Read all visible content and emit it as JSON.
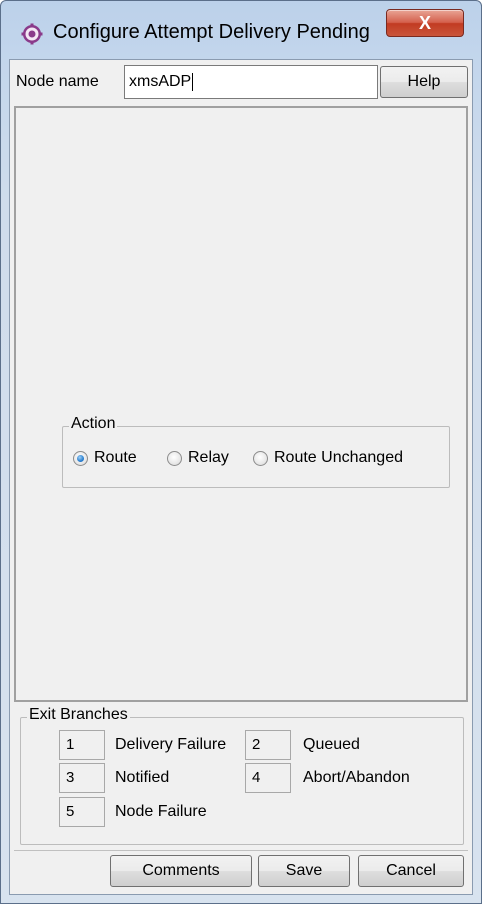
{
  "window": {
    "title": "Configure Attempt Delivery Pending",
    "close_label": "X",
    "app_icon": "gear-app-icon"
  },
  "node": {
    "label": "Node name",
    "value": "xmsADP",
    "help_label": "Help"
  },
  "action": {
    "legend": "Action",
    "options": [
      {
        "label": "Route",
        "checked": true
      },
      {
        "label": "Relay",
        "checked": false
      },
      {
        "label": "Route Unchanged",
        "checked": false
      }
    ]
  },
  "exit_branches": {
    "legend": "Exit Branches",
    "items": [
      {
        "number": "1",
        "label": "Delivery Failure"
      },
      {
        "number": "2",
        "label": "Queued"
      },
      {
        "number": "3",
        "label": "Notified"
      },
      {
        "number": "4",
        "label": "Abort/Abandon"
      },
      {
        "number": "5",
        "label": "Node Failure"
      }
    ]
  },
  "buttons": {
    "comments": "Comments",
    "save": "Save",
    "cancel": "Cancel"
  }
}
